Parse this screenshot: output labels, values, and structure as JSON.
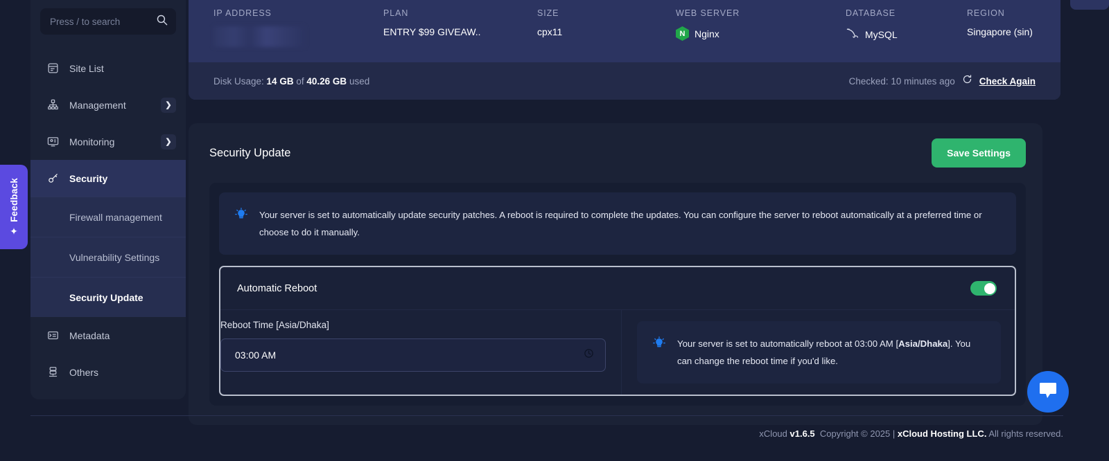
{
  "sidebar": {
    "search": {
      "placeholder": "Press / to search",
      "icon": "search-icon"
    },
    "items": [
      {
        "label": "Site List",
        "icon": "site-list-icon",
        "chevron": "",
        "active": false
      },
      {
        "label": "Management",
        "icon": "management-icon",
        "chevron": "❯",
        "active": false
      },
      {
        "label": "Monitoring",
        "icon": "monitoring-icon",
        "chevron": "❯",
        "active": false
      },
      {
        "label": "Security",
        "icon": "key-icon",
        "chevron": "",
        "active": true
      },
      {
        "label": "Metadata",
        "icon": "metadata-icon",
        "chevron": "",
        "active": false
      },
      {
        "label": "Others",
        "icon": "others-icon",
        "chevron": "",
        "active": false
      }
    ],
    "security_subitems": [
      {
        "label": "Firewall management",
        "active": false
      },
      {
        "label": "Vulnerability Settings",
        "active": false
      },
      {
        "label": "Security Update",
        "active": true
      }
    ]
  },
  "feedback": {
    "label": "Feedback",
    "icon": "sparkle-icon"
  },
  "server_header": {
    "stats": [
      {
        "key": "IP ADDRESS",
        "value": "",
        "redacted": true
      },
      {
        "key": "PLAN",
        "value": "ENTRY $99 GIVEAW.."
      },
      {
        "key": "SIZE",
        "value": "cpx11"
      },
      {
        "key": "WEB SERVER",
        "value": "Nginx",
        "icon": "nginx-icon",
        "badge_letter": "N"
      },
      {
        "key": "DATABASE",
        "value": "MySQL",
        "icon": "mysql-dolphin-icon"
      },
      {
        "key": "REGION",
        "value": "Singapore (sin)"
      }
    ],
    "disk_usage": {
      "prefix": "Disk Usage:",
      "used": "14 GB",
      "of": "of",
      "total": "40.26 GB",
      "suffix": "used"
    },
    "checked_label": "Checked: 10 minutes ago",
    "check_again_label": "Check Again",
    "refresh_icon": "refresh-icon"
  },
  "panel": {
    "title": "Security Update",
    "save_label": "Save Settings",
    "notice": {
      "icon": "lightbulb-icon",
      "text": "Your server is set to automatically update security patches. A reboot is required to complete the updates. You can configure the server to reboot automatically at a preferred time or choose to do it manually."
    },
    "automatic_reboot": {
      "label": "Automatic Reboot",
      "toggle_state": "on",
      "field_label": "Reboot Time [Asia/Dhaka]",
      "time_value": "03:00 AM",
      "time_icon": "clock-icon",
      "notice": {
        "icon": "lightbulb-icon",
        "text_before": "Your server is set to automatically reboot at 03:00 AM [",
        "timezone": "Asia/Dhaka",
        "text_after": "]. You can change the reboot time if you'd like."
      }
    }
  },
  "footer": {
    "app": "xCloud",
    "version": "v1.6.5",
    "copyright": "Copyright © 2025 |",
    "company": "xCloud Hosting LLC.",
    "rights": "All rights reserved."
  },
  "chat": {
    "icon": "chat-bubble-icon"
  },
  "colors": {
    "accent_green": "#2fb46e",
    "sidebar_bg": "#1b2236",
    "header_card": "#2c3461",
    "page_bg": "#161c30",
    "feedback_purple": "#5b4ae0",
    "chat_blue": "#1f6fef",
    "info_blue": "#1f7cf0"
  }
}
